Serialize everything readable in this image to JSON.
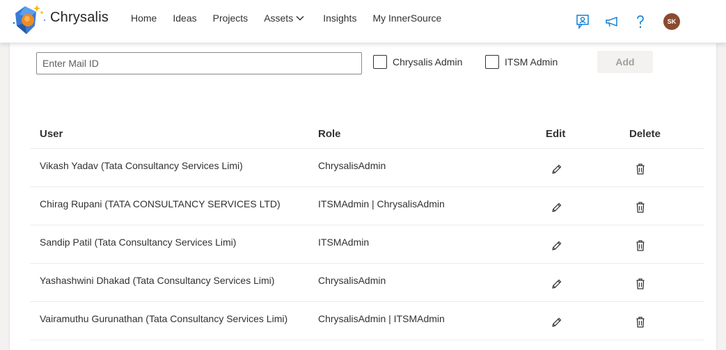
{
  "header": {
    "brand": "Chrysalis",
    "nav": [
      {
        "label": "Home"
      },
      {
        "label": "Ideas"
      },
      {
        "label": "Projects"
      },
      {
        "label": "Assets"
      },
      {
        "label": "Insights"
      },
      {
        "label": "My InnerSource"
      }
    ],
    "avatar_initials": "SK",
    "icons": [
      "feedback-icon",
      "announcement-icon",
      "help-icon"
    ]
  },
  "form": {
    "mail_placeholder": "Enter Mail ID",
    "mail_value": "",
    "checkbox_chrysalis_admin": "Chrysalis Admin",
    "checkbox_itsm_admin": "ITSM Admin",
    "add_label": "Add"
  },
  "table": {
    "columns": {
      "user": "User",
      "role": "Role",
      "edit": "Edit",
      "delete": "Delete"
    },
    "rows": [
      {
        "user": "Vikash Yadav (Tata Consultancy Services Limi)",
        "role": "ChrysalisAdmin"
      },
      {
        "user": "Chirag Rupani (TATA CONSULTANCY SERVICES LTD)",
        "role": "ITSMAdmin | ChrysalisAdmin"
      },
      {
        "user": "Sandip Patil (Tata Consultancy Services Limi)",
        "role": "ITSMAdmin"
      },
      {
        "user": "Yashashwini Dhakad (Tata Consultancy Services Limi)",
        "role": "ChrysalisAdmin"
      },
      {
        "user": "Vairamuthu Gurunathan (Tata Consultancy Services Limi)",
        "role": "ChrysalisAdmin | ITSMAdmin"
      }
    ]
  },
  "colors": {
    "accent": "#0078d4",
    "avatar_bg": "#8a4b2f",
    "text": "#323130"
  }
}
